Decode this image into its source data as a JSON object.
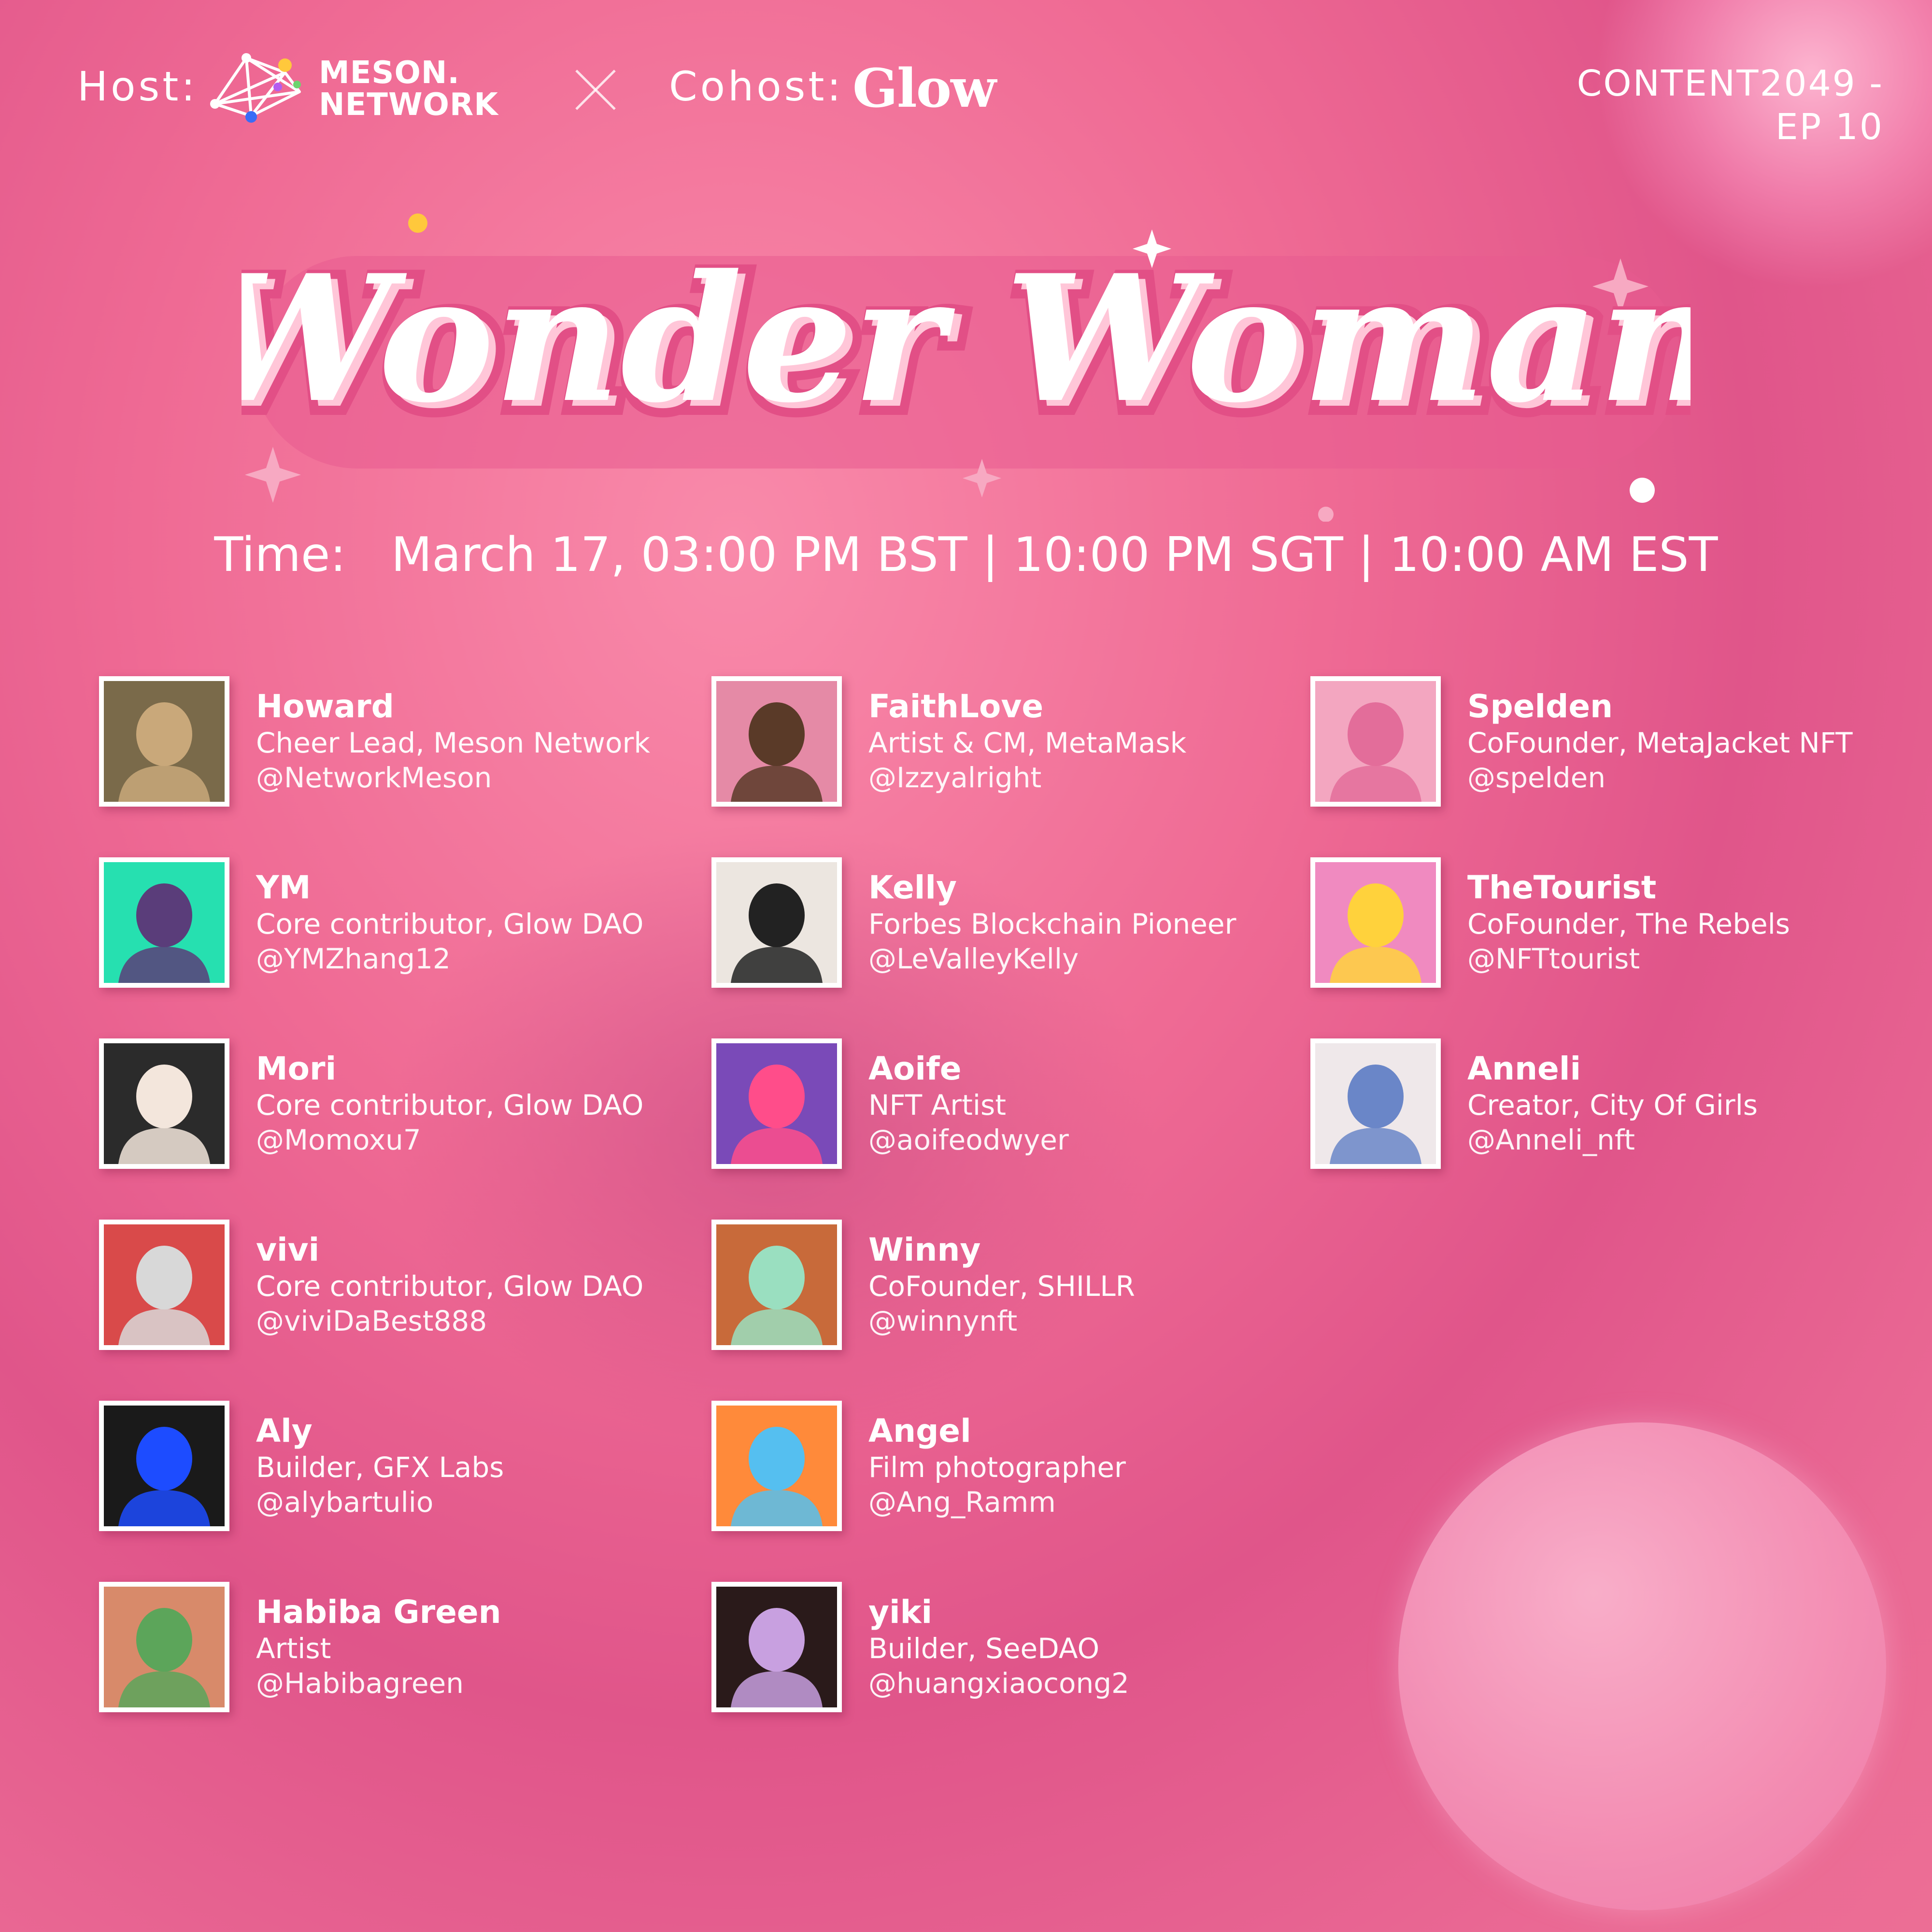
{
  "header": {
    "host_label": "Host:",
    "host_brand": "MESON. NETWORK",
    "host_brand_line1": "MESON.",
    "host_brand_line2": "NETWORK",
    "cohost_label": "Cohost:",
    "cohost_brand": "Glow",
    "episode_line1": "CONTENT2049 -",
    "episode_line2": "EP 10"
  },
  "title": "Wonder Woman",
  "time_label": "Time:",
  "time_value": "March 17, 03:00 PM BST | 10:00 PM SGT | 10:00 AM EST",
  "speakers": [
    {
      "name": "Howard",
      "role": "Cheer Lead, Meson Network",
      "handle": "@NetworkMeson",
      "avatar": "photo-avatar"
    },
    {
      "name": "YM",
      "role": "Core contributor, Glow DAO",
      "handle": "@YMZhang12",
      "avatar": "nft-avatar"
    },
    {
      "name": "Mori",
      "role": "Core contributor, Glow DAO",
      "handle": "@Momoxu7",
      "avatar": "nft-avatar"
    },
    {
      "name": "vivi",
      "role": "Core contributor, Glow DAO",
      "handle": "@viviDaBest888",
      "avatar": "nft-avatar"
    },
    {
      "name": "Aly",
      "role": "Builder, GFX Labs",
      "handle": "@alybartulio",
      "avatar": "photo-avatar"
    },
    {
      "name": "Habiba Green",
      "role": "Artist",
      "handle": "@Habibagreen",
      "avatar": "nft-avatar"
    },
    {
      "name": "FaithLove",
      "role": "Artist & CM, MetaMask",
      "handle": "@Izzyalright",
      "avatar": "nft-avatar"
    },
    {
      "name": "Kelly",
      "role": "Forbes Blockchain Pioneer",
      "handle": "@LeValleyKelly",
      "avatar": "photo-avatar"
    },
    {
      "name": "Aoife",
      "role": "NFT Artist",
      "handle": "@aoifeodwyer",
      "avatar": "nft-avatar"
    },
    {
      "name": "Winny",
      "role": "CoFounder, SHILLR",
      "handle": "@winnynft",
      "avatar": "nft-avatar"
    },
    {
      "name": "Angel",
      "role": "Film photographer",
      "handle": "@Ang_Ramm",
      "avatar": "nft-avatar"
    },
    {
      "name": "yiki",
      "role": "Builder, SeeDAO",
      "handle": "@huangxiaocong2",
      "avatar": "nft-avatar"
    },
    {
      "name": "Spelden",
      "role": "CoFounder, MetaJacket NFT",
      "handle": "@spelden",
      "avatar": "nft-avatar"
    },
    {
      "name": "TheTourist",
      "role": "CoFounder, The Rebels",
      "handle": "@NFTtourist",
      "avatar": "nft-avatar"
    },
    {
      "name": "Anneli",
      "role": "Creator, City Of Girls",
      "handle": "@Anneli_nft",
      "avatar": "nft-avatar"
    }
  ],
  "colors": {
    "background": "#ec6a94",
    "title_fill": "#ffffff",
    "title_outline": "#e24f86",
    "title_shadow": "#ffc6d8",
    "text": "#ffffff"
  }
}
